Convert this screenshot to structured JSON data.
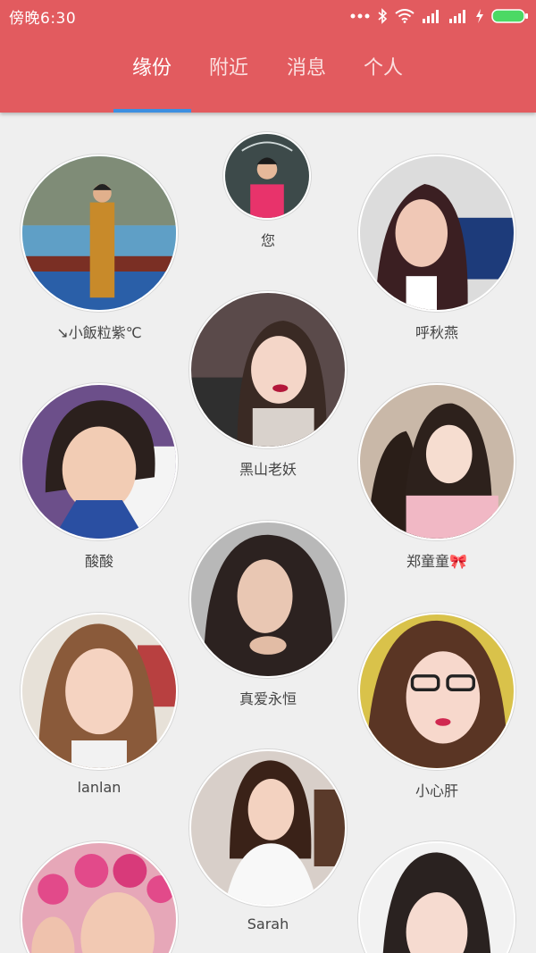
{
  "status_bar": {
    "time": "傍晚6:30",
    "icons": [
      "more-dots-icon",
      "bluetooth-icon",
      "wifi-icon",
      "signal-icon",
      "signal-icon",
      "charging-icon",
      "battery-icon"
    ],
    "battery_color": "#4cd964"
  },
  "colors": {
    "header": "#e25b5f",
    "tab_indicator": "#3d8fe0",
    "background": "#efefef"
  },
  "tabs": [
    {
      "label": "缘份",
      "active": true
    },
    {
      "label": "附近",
      "active": false
    },
    {
      "label": "消息",
      "active": false
    },
    {
      "label": "个人",
      "active": false
    }
  ],
  "profiles": [
    {
      "name": "您"
    },
    {
      "name": "↘小飯粒紫℃"
    },
    {
      "name": "呼秋燕"
    },
    {
      "name": "黑山老妖"
    },
    {
      "name": "酸酸"
    },
    {
      "name": "郑童童🎀"
    },
    {
      "name": "真爱永恒"
    },
    {
      "name": "lanlan"
    },
    {
      "name": "小心肝"
    },
    {
      "name": "Sarah"
    },
    {
      "name": ""
    },
    {
      "name": ""
    }
  ]
}
